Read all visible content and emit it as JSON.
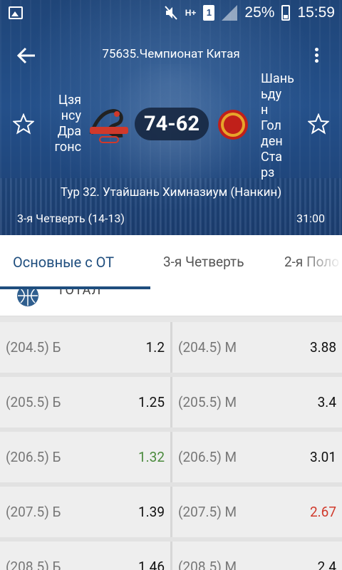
{
  "status_bar": {
    "battery": "25%",
    "time": "15:59",
    "sim": "1",
    "network": "H+"
  },
  "toolbar": {
    "title": "75635.Чемпионат Китая"
  },
  "match": {
    "home_team": "Цзя нсу Дра гонс",
    "home_team_lines": [
      "Цзя",
      "нсу",
      "Дра",
      "гонс"
    ],
    "away_team": "Шань ьду н Гол ден Ста рз",
    "away_team_lines": [
      "Шань",
      "ьду",
      "н",
      "Гол",
      "ден",
      "Ста",
      "рз"
    ],
    "score": "74-62",
    "venue": "Тур 32. Утайшань Химназиум (Нанкин)",
    "period": "3-я  Четверть (14-13)",
    "clock": "31:00"
  },
  "tabs": [
    {
      "label": "Основные с ОТ",
      "active": true
    },
    {
      "label": "3-я  Четверть",
      "active": false
    },
    {
      "label": "2-я  Поло",
      "active": false
    }
  ],
  "section": {
    "title": "ТОТАЛ",
    "icon": "basketball-icon"
  },
  "odds_rows": [
    {
      "over_label": "(204.5) Б",
      "over_value": "1.2",
      "over_color": "#111111",
      "under_label": "(204.5) М",
      "under_value": "3.88",
      "under_color": "#111111"
    },
    {
      "over_label": "(205.5) Б",
      "over_value": "1.25",
      "over_color": "#111111",
      "under_label": "(205.5) М",
      "under_value": "3.4",
      "under_color": "#111111"
    },
    {
      "over_label": "(206.5) Б",
      "over_value": "1.32",
      "over_color": "#4a8a3c",
      "under_label": "(206.5) М",
      "under_value": "3.01",
      "under_color": "#111111"
    },
    {
      "over_label": "(207.5) Б",
      "over_value": "1.39",
      "over_color": "#111111",
      "under_label": "(207.5) М",
      "under_value": "2.67",
      "under_color": "#d0392b"
    },
    {
      "over_label": "(208.5) Б",
      "over_value": "1.46",
      "over_color": "#111111",
      "under_label": "(208.5) М",
      "under_value": "2.4",
      "under_color": "#111111"
    }
  ],
  "colors": {
    "header_blue": "#24508a",
    "accent": "#1f4e7e",
    "up": "#4a8a3c",
    "down": "#d0392b"
  }
}
